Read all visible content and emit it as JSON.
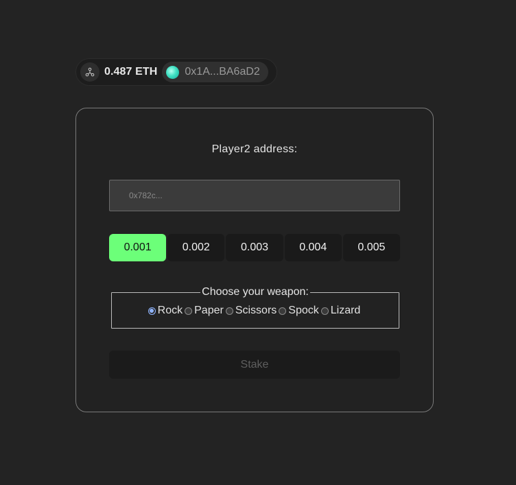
{
  "wallet": {
    "balance": "0.487 ETH",
    "address": "0x1A...BA6aD2"
  },
  "form": {
    "player2_label": "Player2 address:",
    "player2_placeholder": "0x782c...",
    "player2_value": "",
    "amounts": [
      "0.001",
      "0.002",
      "0.003",
      "0.004",
      "0.005"
    ],
    "selected_amount": "0.001",
    "weapon_legend": "Choose your weapon:",
    "weapons": [
      "Rock",
      "Paper",
      "Scissors",
      "Spock",
      "Lizard"
    ],
    "selected_weapon": "Rock",
    "stake_label": "Stake"
  },
  "colors": {
    "accent": "#6cff79",
    "background": "#232323"
  }
}
